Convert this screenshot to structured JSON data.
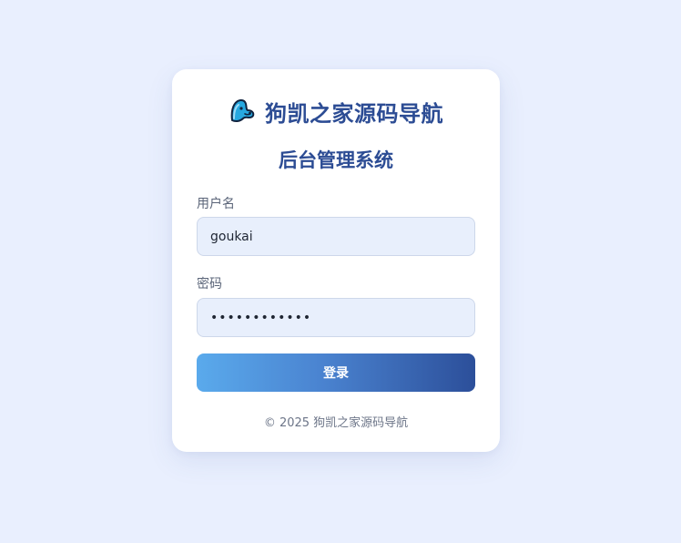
{
  "brand": {
    "logo_icon": "mascot-logo-icon",
    "name": "狗凯之家源码导航"
  },
  "subtitle": "后台管理系统",
  "form": {
    "username_label": "用户名",
    "username_value": "goukai",
    "password_label": "密码",
    "password_value": "goukai123456",
    "submit_label": "登录"
  },
  "footer": "© 2025 狗凯之家源码导航",
  "colors": {
    "background": "#e9effe",
    "accent": "#2c4c94",
    "button_gradient_start": "#5aaaec",
    "button_gradient_end": "#2c4f9a",
    "input_background": "#e8effc"
  }
}
